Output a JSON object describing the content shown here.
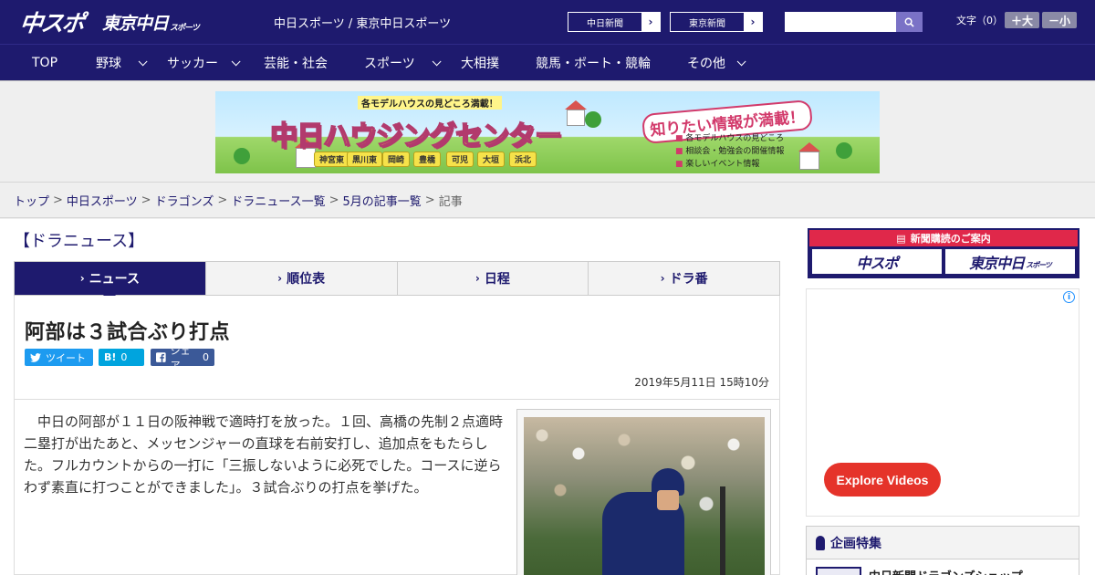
{
  "header": {
    "logo_main": "中スポ",
    "logo_tokyo": "東京中日",
    "logo_tokyo_small": "スポーツ",
    "site_title": "中日スポーツ / 東京中日スポーツ",
    "ext_links": [
      {
        "label": "中日新聞",
        "arrow": "›"
      },
      {
        "label": "東京新聞",
        "arrow": "›"
      }
    ],
    "search_placeholder": "",
    "search_icon": "search-icon",
    "fontsize_label": "文字（0）",
    "fontsize_plus": "＋大",
    "fontsize_minus": "－小"
  },
  "nav": {
    "items": [
      {
        "label": "TOP",
        "has_menu": false
      },
      {
        "label": "野球",
        "has_menu": true
      },
      {
        "label": "サッカー",
        "has_menu": true
      },
      {
        "label": "芸能・社会",
        "has_menu": false
      },
      {
        "label": "スポーツ",
        "has_menu": true
      },
      {
        "label": "大相撲",
        "has_menu": false
      },
      {
        "label": "競馬・ボート・競輪",
        "has_menu": false
      },
      {
        "label": "その他",
        "has_menu": true
      }
    ]
  },
  "banner": {
    "kicker": "各モデルハウスの見どころ満載！",
    "title": "中日ハウジングセンター",
    "slogan": "知りたい情報が満載！",
    "locations": [
      "神宮東",
      "黒川東",
      "岡崎",
      "豊橋",
      "可児",
      "大垣",
      "浜北"
    ],
    "info": [
      "各モデルハウスの見どころ",
      "相談会・勉強会の開催情報",
      "楽しいイベント情報"
    ]
  },
  "breadcrumb": {
    "items": [
      "トップ",
      "中日スポーツ",
      "ドラゴンズ",
      "ドラニュース一覧",
      "5月の記事一覧"
    ],
    "current": "記事",
    "separator": ">"
  },
  "section": {
    "title": "【ドラニュース】"
  },
  "tabs": [
    {
      "label": "ニュース",
      "active": true
    },
    {
      "label": "順位表",
      "active": false
    },
    {
      "label": "日程",
      "active": false
    },
    {
      "label": "ドラ番",
      "active": false
    }
  ],
  "article": {
    "title": "阿部は３試合ぶり打点",
    "share": {
      "tweet": "ツイート",
      "hatena_icon": "B!",
      "hatena_count": "0",
      "facebook_label": "シェア",
      "facebook_count": "0"
    },
    "date": "2019年5月11日 15時10分",
    "body": "中日の阿部が１１日の阪神戦で適時打を放った。１回、高橋の先制２点適時二塁打が出たあと、メッセンジャーの直球を右前安打し、追加点をもたらした。フルカウントからの一打に「三振しないように必死でした。コースに逆らわず素直に打つことができました」。３試合ぶりの打点を挙げた。"
  },
  "sidebar": {
    "subscribe_head": "新聞購読のご案内",
    "subscribe_logos": [
      "中スポ",
      "東京中日"
    ],
    "subscribe_logo_small": "スポーツ",
    "ad_info": "i",
    "explore_label": "Explore Videos",
    "feature_title": "企画特集",
    "feature_item": "中日新聞ドラゴンズショップ"
  },
  "colors": {
    "brand_navy": "#1e1a6e",
    "accent_red": "#e5332a",
    "twitter": "#1d9bf0",
    "hatena": "#00a4de",
    "facebook": "#3b5998"
  }
}
